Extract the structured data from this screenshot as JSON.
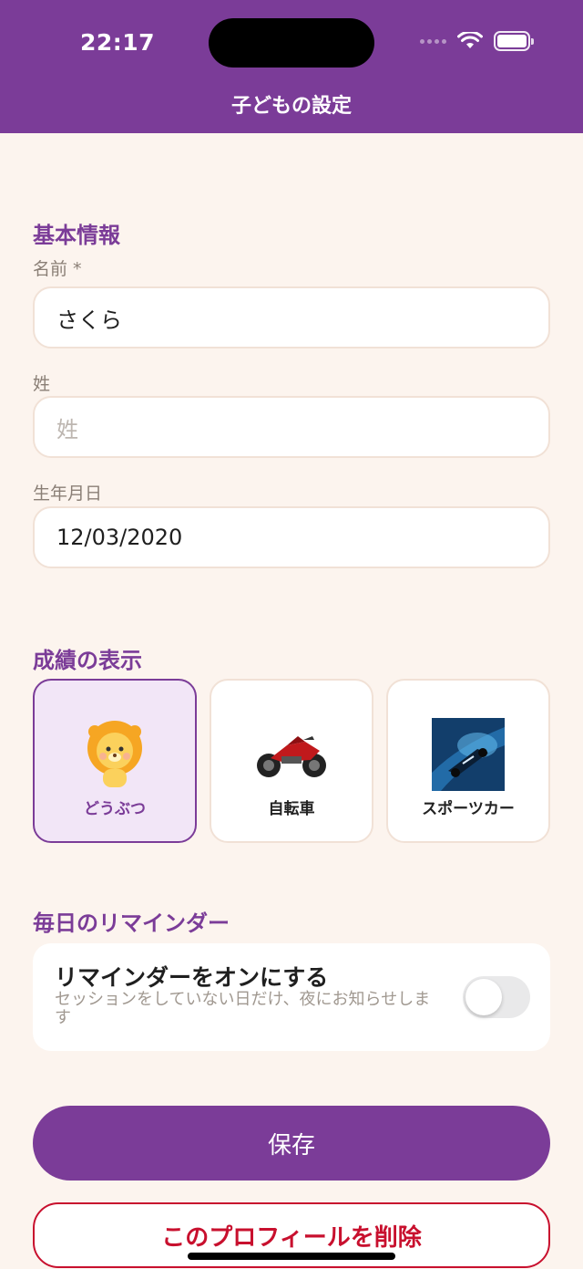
{
  "status_bar": {
    "time": "22:17"
  },
  "header": {
    "title": "子どもの設定"
  },
  "basic_info": {
    "section_title": "基本情報",
    "first_name": {
      "label": "名前 *",
      "value": "さくら"
    },
    "last_name": {
      "label": "姓",
      "placeholder": "姓"
    },
    "birthdate": {
      "label": "生年月日",
      "value": "12/03/2020"
    }
  },
  "display": {
    "section_title": "成績の表示",
    "options": [
      {
        "label": "どうぶつ",
        "icon": "lion-icon",
        "selected": true
      },
      {
        "label": "自転車",
        "icon": "motorcycle-icon",
        "selected": false
      },
      {
        "label": "スポーツカー",
        "icon": "race-car-icon",
        "selected": false
      }
    ]
  },
  "reminder": {
    "section_title": "毎日のリマインダー",
    "title": "リマインダーをオンにする",
    "description": "セッションをしていない日だけ、夜にお知らせします",
    "enabled": false
  },
  "buttons": {
    "save": "保存",
    "delete": "このプロフィールを削除"
  },
  "colors": {
    "accent": "#7b3c98",
    "background": "#fcf4ee",
    "danger": "#c8102e"
  }
}
